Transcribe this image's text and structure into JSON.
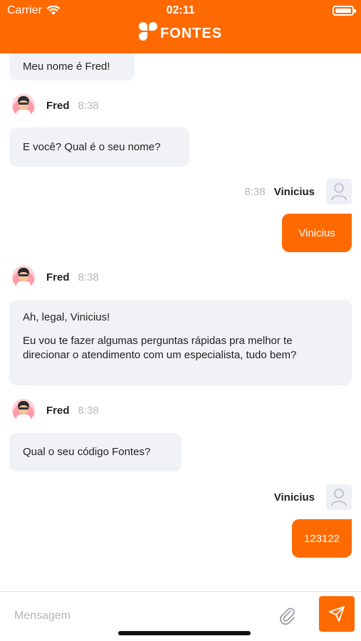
{
  "status_bar": {
    "carrier": "Carrier",
    "time": "02:11"
  },
  "header": {
    "brand": "FONTES"
  },
  "messages": [
    {
      "from": "bot",
      "text": "Meu nome é Fred!"
    },
    {
      "from": "bot",
      "sender": "Fred",
      "time": "8:38",
      "text": "E você? Qual é o seu nome?"
    },
    {
      "from": "user",
      "sender": "Vinicius",
      "time": "8:38",
      "text": "Vinicius"
    },
    {
      "from": "bot",
      "sender": "Fred",
      "time": "8:38",
      "line1": "Ah, legal, Vinicius!",
      "line2": "Eu vou te fazer algumas perguntas rápidas pra melhor te direcionar o atendimento com um especialista, tudo bem?"
    },
    {
      "from": "bot",
      "sender": "Fred",
      "time": "8:38",
      "text": "Qual o seu código Fontes?"
    },
    {
      "from": "user",
      "sender": "Vinicius",
      "text": "123122"
    }
  ],
  "composer": {
    "placeholder": "Mensagem",
    "attach_icon": "paperclip-icon",
    "send_icon": "send-icon"
  },
  "colors": {
    "accent": "#ff6a00",
    "bubble_in": "#f1f2f6",
    "muted": "#b7b7bf"
  }
}
